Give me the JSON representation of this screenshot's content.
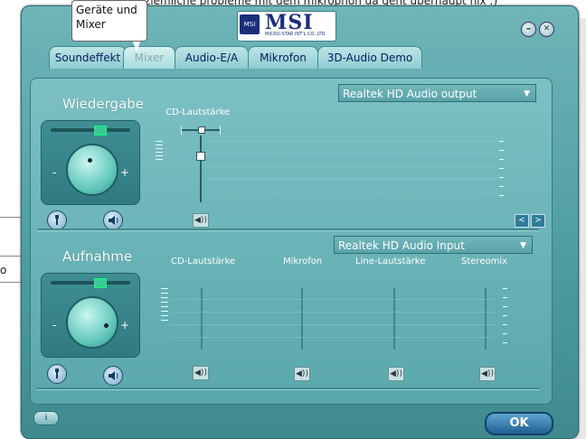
{
  "background": {
    "partial_text": "ziemliche probleme mit dem mikrophon da geht überhaupt nix :)",
    "left_char": "o"
  },
  "window": {
    "logo_text": "MSI",
    "logo_emblem": "MSI",
    "logo_subtext": "MICRO-STAR INT'L CO.,LTD.",
    "minimize_glyph": "–",
    "close_glyph": "✕"
  },
  "tooltip": {
    "text": "Geräte und Mixer"
  },
  "tabs": [
    {
      "label": "Soundeffekt",
      "active": false
    },
    {
      "label": "Mixer",
      "active": true
    },
    {
      "label": "Audio-E/A",
      "active": false
    },
    {
      "label": "Mikrofon",
      "active": false
    },
    {
      "label": "3D-Audio Demo",
      "active": false
    }
  ],
  "playback": {
    "title": "Wiedergabe",
    "device": "Realtek HD Audio output",
    "channels": [
      {
        "label": "CD-Lautstärke"
      }
    ],
    "knob_minus": "-",
    "knob_plus": "+",
    "prev_glyph": "<",
    "next_glyph": ">"
  },
  "recording": {
    "title": "Aufnahme",
    "device": "Realtek HD Audio Input",
    "channels": [
      {
        "label": "CD-Lautstärke"
      },
      {
        "label": "Mikrofon"
      },
      {
        "label": "Line-Lautstärke"
      },
      {
        "label": "Stereomix"
      }
    ],
    "knob_minus": "-",
    "knob_plus": "+"
  },
  "footer": {
    "ok_label": "OK",
    "info_label": "i"
  },
  "icons": {
    "speaker": "speaker-icon",
    "wrench": "wrench-icon",
    "mute": "mute-icon"
  },
  "colors": {
    "window_teal": "#5aa8ac",
    "ok_blue": "#1f5f93",
    "tab_text": "#0a1a60"
  }
}
